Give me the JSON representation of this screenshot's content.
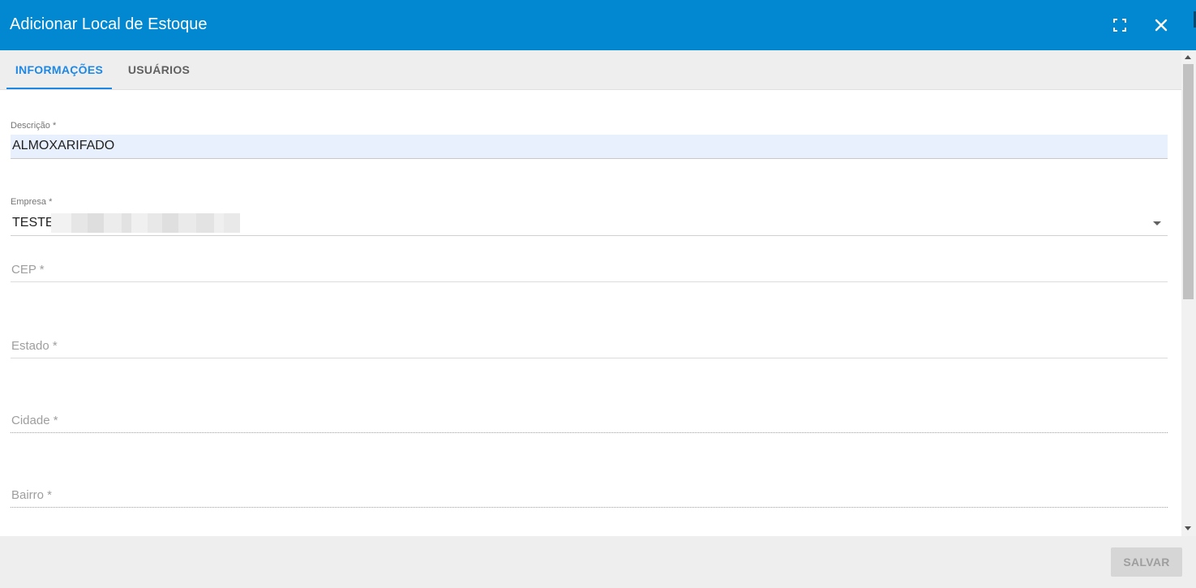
{
  "header": {
    "title": "Adicionar Local de Estoque",
    "maximize_icon": "fullscreen-icon",
    "close_icon": "close-icon",
    "color": "#0288d1"
  },
  "tabs": [
    {
      "label": "INFORMAÇÕES",
      "active": true
    },
    {
      "label": "USUÁRIOS",
      "active": false
    }
  ],
  "form": {
    "descricao": {
      "label": "Descrição *",
      "value": "ALMOXARIFADO"
    },
    "empresa": {
      "label": "Empresa *",
      "value": "TESTE"
    },
    "cep": {
      "placeholder": "CEP *"
    },
    "estado": {
      "placeholder": "Estado *"
    },
    "cidade": {
      "placeholder": "Cidade *"
    },
    "bairro": {
      "placeholder": "Bairro *"
    }
  },
  "footer": {
    "save_label": "SALVAR"
  },
  "colors": {
    "accent": "#1e88e5",
    "autofill": "#e8f0fe"
  }
}
